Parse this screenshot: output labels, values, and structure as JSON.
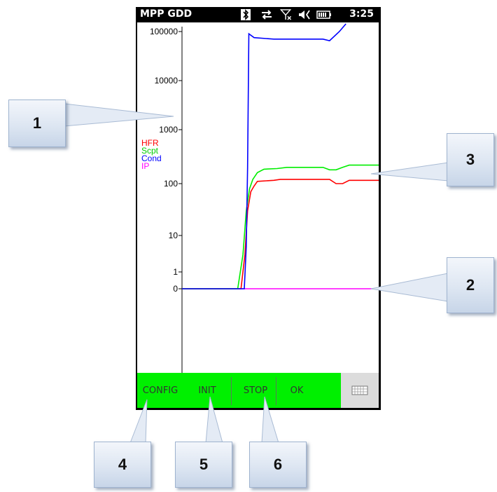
{
  "app": {
    "title": "MPP GDD",
    "time": "3:25"
  },
  "status_icons": [
    "bluetooth-icon",
    "sync-icon",
    "signal-off-icon",
    "volume-icon",
    "battery-icon"
  ],
  "chart_data": {
    "type": "line",
    "yscale": "log",
    "y_ticks": [
      "100000",
      "10000",
      "1000",
      "100",
      "10",
      "1",
      "0"
    ],
    "legend": [
      {
        "name": "HFR",
        "color": "#ff0000"
      },
      {
        "name": "Scpt",
        "color": "#00ee00"
      },
      {
        "name": "Cond",
        "color": "#0000ff"
      },
      {
        "name": "IP",
        "color": "#ff00ff"
      }
    ],
    "x_range": [
      0,
      300
    ],
    "series": [
      {
        "name": "HFR",
        "color": "#ff0000",
        "points": [
          [
            0,
            0
          ],
          [
            90,
            0
          ],
          [
            96,
            3
          ],
          [
            100,
            30
          ],
          [
            105,
            70
          ],
          [
            110,
            90
          ],
          [
            115,
            110
          ],
          [
            140,
            115
          ],
          [
            150,
            120
          ],
          [
            170,
            120
          ],
          [
            225,
            120
          ],
          [
            235,
            100
          ],
          [
            245,
            100
          ],
          [
            255,
            115
          ],
          [
            300,
            115
          ]
        ]
      },
      {
        "name": "Scpt",
        "color": "#00ee00",
        "points": [
          [
            0,
            0
          ],
          [
            85,
            0
          ],
          [
            93,
            3
          ],
          [
            98,
            30
          ],
          [
            103,
            80
          ],
          [
            108,
            120
          ],
          [
            115,
            160
          ],
          [
            125,
            185
          ],
          [
            145,
            190
          ],
          [
            160,
            200
          ],
          [
            215,
            200
          ],
          [
            225,
            180
          ],
          [
            235,
            180
          ],
          [
            245,
            200
          ],
          [
            255,
            220
          ],
          [
            300,
            220
          ]
        ]
      },
      {
        "name": "Cond",
        "color": "#0000ff",
        "points": [
          [
            0,
            0
          ],
          [
            95,
            0
          ],
          [
            98,
            5
          ],
          [
            100,
            200
          ],
          [
            102,
            90000
          ],
          [
            110,
            75000
          ],
          [
            140,
            70000
          ],
          [
            170,
            70000
          ],
          [
            195,
            70000
          ],
          [
            215,
            70000
          ],
          [
            225,
            65000
          ],
          [
            240,
            100000
          ],
          [
            250,
            200000
          ]
        ]
      },
      {
        "name": "IP",
        "color": "#ff00ff",
        "points": [
          [
            0,
            0
          ],
          [
            300,
            0
          ]
        ]
      }
    ]
  },
  "toolbar": {
    "config": "CONFIG",
    "init": "INIT",
    "stop": "STOP",
    "ok": "OK",
    "keyboard_icon": "keyboard-icon"
  },
  "callouts": [
    "1",
    "2",
    "3",
    "4",
    "5",
    "6"
  ]
}
